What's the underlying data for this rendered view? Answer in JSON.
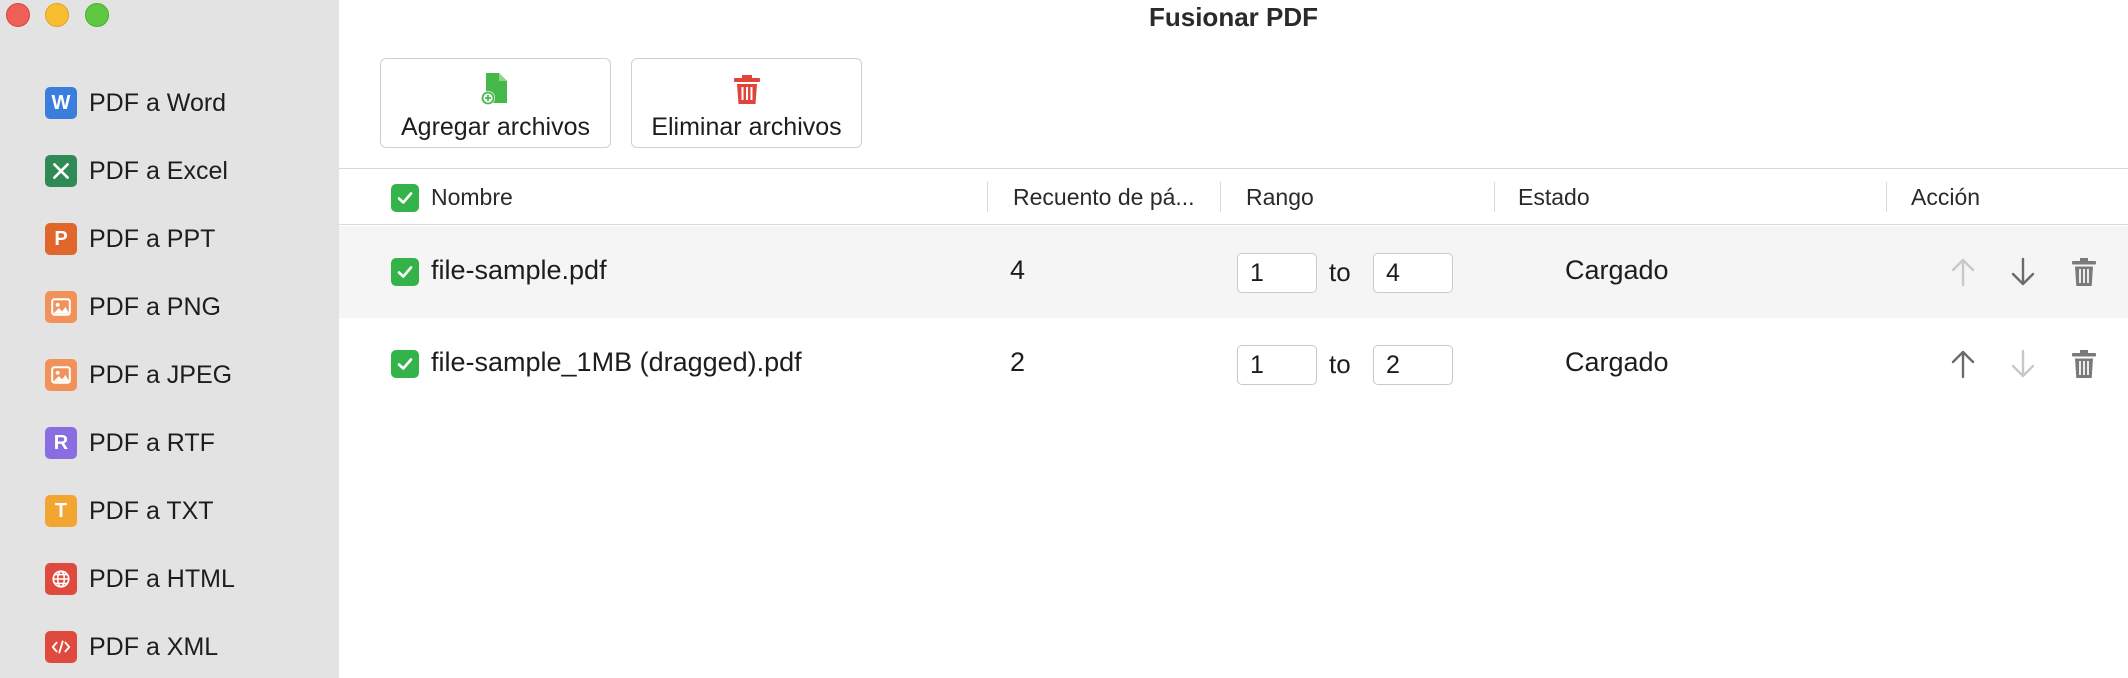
{
  "window": {
    "title": "Fusionar PDF"
  },
  "sidebar": {
    "items": [
      {
        "label": "PDF a Word",
        "icon": "word-icon",
        "glyph": "W",
        "color": "#3b7ddd"
      },
      {
        "label": "PDF a Excel",
        "icon": "excel-icon",
        "glyph": "✕",
        "color": "#2f8a55"
      },
      {
        "label": "PDF a PPT",
        "icon": "ppt-icon",
        "glyph": "P",
        "color": "#e0662b"
      },
      {
        "label": "PDF a PNG",
        "icon": "image-icon",
        "glyph": "",
        "color": "#f0925a"
      },
      {
        "label": "PDF a JPEG",
        "icon": "image-icon",
        "glyph": "",
        "color": "#f0925a"
      },
      {
        "label": "PDF a RTF",
        "icon": "rtf-icon",
        "glyph": "R",
        "color": "#8a6de0"
      },
      {
        "label": "PDF a TXT",
        "icon": "txt-icon",
        "glyph": "T",
        "color": "#f2a531"
      },
      {
        "label": "PDF a HTML",
        "icon": "globe-icon",
        "glyph": "",
        "color": "#e04a3e"
      },
      {
        "label": "PDF a XML",
        "icon": "code-icon",
        "glyph": "</>",
        "color": "#e04a3e"
      }
    ]
  },
  "toolbar": {
    "add_label": "Agregar archivos",
    "remove_label": "Eliminar archivos",
    "add_color": "#46b84a",
    "remove_color": "#e0453b"
  },
  "table": {
    "columns": {
      "name": "Nombre",
      "pages": "Recuento de pá...",
      "range": "Rango",
      "status": "Estado",
      "action": "Acción"
    },
    "rows": [
      {
        "name": "file-sample.pdf",
        "pages": "4",
        "range_from": "1",
        "to": "to",
        "range_to": "4",
        "status": "Cargado",
        "can_up": false,
        "can_down": true
      },
      {
        "name": "file-sample_1MB (dragged).pdf",
        "pages": "2",
        "range_from": "1",
        "to": "to",
        "range_to": "2",
        "status": "Cargado",
        "can_up": true,
        "can_down": false
      }
    ]
  },
  "colors": {
    "checkbox": "#34b34a",
    "sidebar_bg": "#e3e3e3"
  }
}
